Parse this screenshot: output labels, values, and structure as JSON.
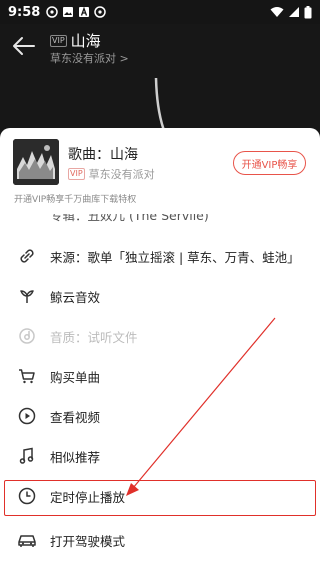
{
  "status_bar": {
    "time": "9:58"
  },
  "header": {
    "vip_badge": "VIP",
    "title": "山海",
    "subtitle": "草东没有派对 >"
  },
  "song_card": {
    "title": "歌曲：山海",
    "vip_badge": "VIP",
    "artist": "草东没有派对",
    "vip_button": "开通VIP畅享",
    "tip": "开通VIP畅享千万曲库下载特权"
  },
  "menu": {
    "items": [
      {
        "label": "专辑：丑奴儿 (The Servile)",
        "icon": "album-icon"
      },
      {
        "label": "来源：歌单「独立摇滚 | 草东、万青、蛙池」",
        "icon": "link-icon"
      },
      {
        "label": "鲸云音效",
        "icon": "whale-icon"
      },
      {
        "label": "音质：试听文件",
        "icon": "quality-icon"
      },
      {
        "label": "购买单曲",
        "icon": "cart-icon"
      },
      {
        "label": "查看视频",
        "icon": "play-icon"
      },
      {
        "label": "相似推荐",
        "icon": "music-note-icon"
      },
      {
        "label": "定时停止播放",
        "icon": "clock-icon"
      },
      {
        "label": "打开驾驶模式",
        "icon": "car-icon"
      }
    ]
  },
  "colors": {
    "accent": "#e8544a",
    "annotation": "#e0302a"
  }
}
